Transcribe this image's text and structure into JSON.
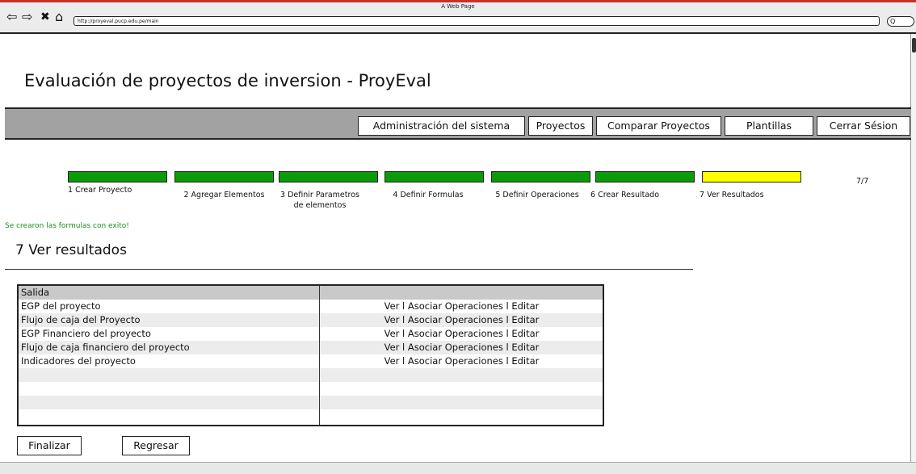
{
  "browser": {
    "window_title": "A Web Page",
    "url": "http://proyeval.pucp.edu.pe/main",
    "search_glyph": "Q"
  },
  "app": {
    "title": "Evaluación de proyectos de inversion - ProyEval"
  },
  "menu": {
    "items": [
      {
        "label": "Administración del sistema"
      },
      {
        "label": "Proyectos"
      },
      {
        "label": "Comparar Proyectos"
      },
      {
        "label": "Plantillas"
      },
      {
        "label": "Cerrar Sésion"
      }
    ]
  },
  "steps": {
    "items": [
      {
        "label": "1 Crear Proyecto",
        "status": "done",
        "color": "#0a9a0a"
      },
      {
        "label": "2 Agregar Elementos",
        "status": "done",
        "color": "#0a9a0a"
      },
      {
        "label": "3 Definir Parametros de elementos",
        "status": "done",
        "color": "#0a9a0a"
      },
      {
        "label": "4 Definir Formulas",
        "status": "done",
        "color": "#0a9a0a"
      },
      {
        "label": "5 Definir Operaciones",
        "status": "done",
        "color": "#0a9a0a"
      },
      {
        "label": "6 Crear Resultado",
        "status": "done",
        "color": "#0a9a0a"
      },
      {
        "label": "7 Ver Resultados",
        "status": "current",
        "color": "#ffff00"
      }
    ],
    "counter": "7/7"
  },
  "message": "Se crearon las formulas con exito!",
  "section": {
    "title": "7 Ver resultados"
  },
  "table": {
    "header": "Salida",
    "rows": [
      {
        "name": "EGP del proyecto",
        "actions": "Ver l Asociar Operaciones l Editar"
      },
      {
        "name": "Flujo de caja del Proyecto",
        "actions": "Ver l Asociar Operaciones l Editar"
      },
      {
        "name": "EGP Financiero del proyecto",
        "actions": "Ver l Asociar Operaciones l Editar"
      },
      {
        "name": "Flujo de caja financiero del proyecto",
        "actions": "Ver l Asociar Operaciones l Editar"
      },
      {
        "name": "Indicadores del proyecto",
        "actions": "Ver l Asociar Operaciones l Editar"
      },
      {
        "name": "",
        "actions": ""
      },
      {
        "name": "",
        "actions": ""
      },
      {
        "name": "",
        "actions": ""
      },
      {
        "name": "",
        "actions": ""
      }
    ]
  },
  "buttons": {
    "finish": "Finalizar",
    "back": "Regresar"
  },
  "colors": {
    "header_row": "#c9c9c9",
    "row_alt": "#ececec",
    "menu_bar": "#a2a2a2",
    "success_text": "#1e8f1e"
  }
}
